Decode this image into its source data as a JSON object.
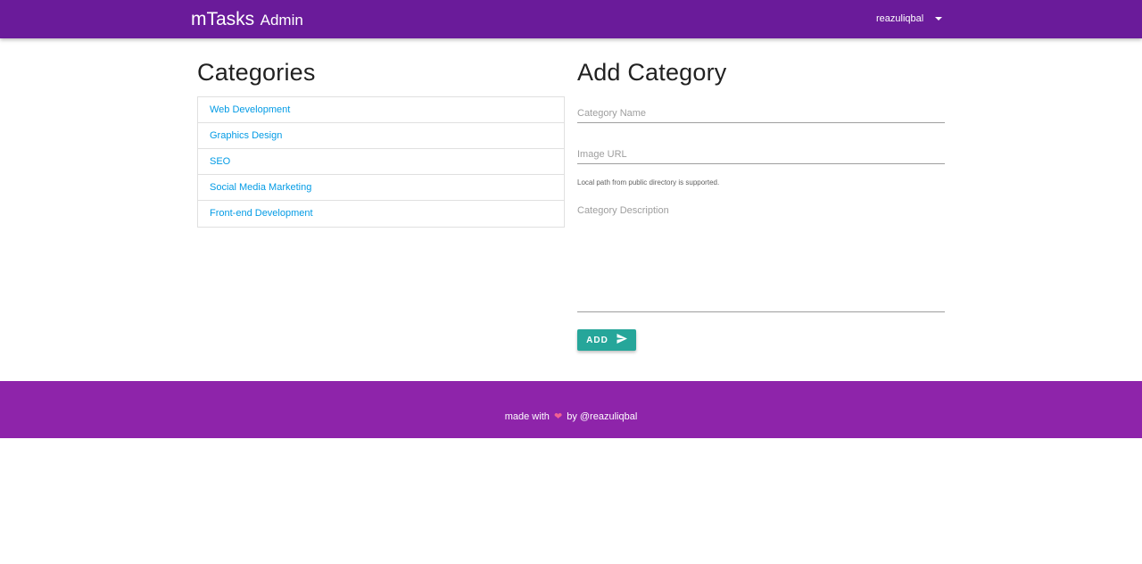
{
  "navbar": {
    "brand_main": "mTasks",
    "brand_sub": "Admin",
    "username": "reazuliqbal",
    "menu_icon": "caret-down-icon",
    "background": "#6a1b9a"
  },
  "categories": {
    "title": "Categories",
    "items": [
      {
        "label": "Web Development"
      },
      {
        "label": "Graphics Design"
      },
      {
        "label": "SEO"
      },
      {
        "label": "Social Media Marketing"
      },
      {
        "label": "Front-end Development"
      }
    ],
    "link_color": "#039be5"
  },
  "add_category": {
    "title": "Add Category",
    "name_placeholder": "Category Name",
    "name_value": "",
    "image_placeholder": "Image URL",
    "image_value": "",
    "image_helper": "Local path from public directory is supported.",
    "description_placeholder": "Category Description",
    "description_value": "",
    "button_label": "ADD",
    "button_icon": "send-icon",
    "button_color": "#26a69a"
  },
  "footer": {
    "text_before": "made with",
    "heart_icon": "heart-icon",
    "text_after": "by @reazuliqbal",
    "background": "#8e24aa"
  }
}
